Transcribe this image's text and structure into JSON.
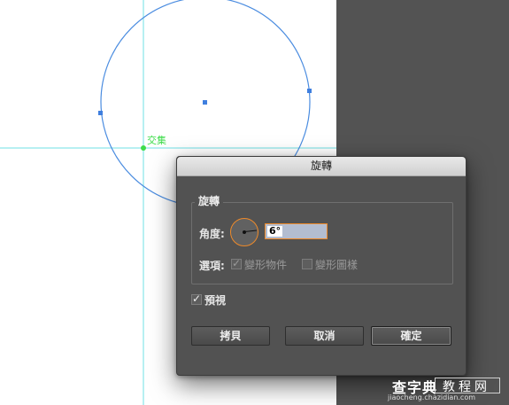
{
  "colors": {
    "guide": "#6fe0e6",
    "ellipse": "#4a8ce0",
    "anchor": "#3f7fdf",
    "smart_guide": "#3ddc4a",
    "dialog_bg": "#525252",
    "pasteboard": "#535353",
    "focus": "#ee8a2a"
  },
  "canvas": {
    "smart_guide_label": "交集"
  },
  "dialog": {
    "title": "旋轉",
    "group_title": "旋轉",
    "angle_label": "角度:",
    "angle_value": "6°",
    "options_label": "選項:",
    "options": [
      {
        "label": "變形物件",
        "checked": true,
        "enabled": false
      },
      {
        "label": "變形圖樣",
        "checked": false,
        "enabled": false
      }
    ],
    "preview_label": "預視",
    "preview_checked": true,
    "buttons": {
      "copy": "拷貝",
      "cancel": "取消",
      "ok": "確定"
    }
  },
  "watermark": {
    "brand": "查字典",
    "brand2": "教程网",
    "url": "jiaocheng.chazidian.com"
  }
}
